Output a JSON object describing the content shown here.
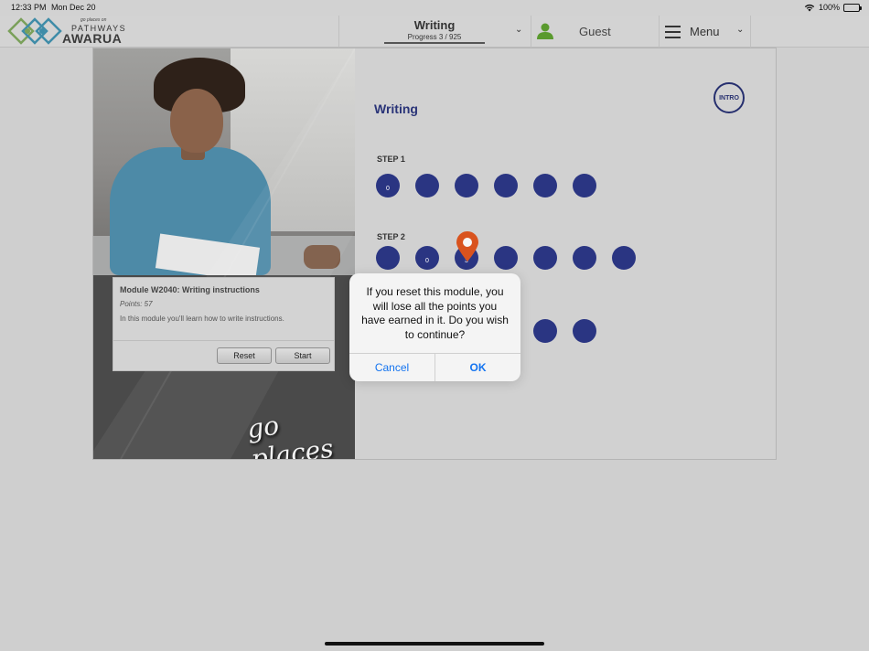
{
  "status_bar": {
    "time": "12:33 PM",
    "date": "Mon Dec 20",
    "battery": "100%",
    "battery_level": 1.0
  },
  "header": {
    "logo": {
      "tagline": "go places on",
      "line1": "PATHWAYS",
      "line2": "AWARUA"
    },
    "title": "Writing",
    "progress_text": "Progress  3 / 925",
    "user_label": "Guest",
    "menu_label": "Menu"
  },
  "module_card": {
    "title": "Module W2040: Writing instructions",
    "points": "Points: 57",
    "description": "In this module you'll learn how to write instructions.",
    "reset_label": "Reset",
    "start_label": "Start"
  },
  "banner_text": "go places",
  "map": {
    "heading": "Writing",
    "intro_label": "INTRO",
    "steps": [
      {
        "label": "STEP 1",
        "dots": [
          "0",
          "",
          "",
          "",
          "",
          ""
        ]
      },
      {
        "label": "STEP 2",
        "dots": [
          "",
          "0",
          "3",
          "",
          "",
          "",
          ""
        ]
      }
    ]
  },
  "dialog": {
    "message": "If you reset this module, you will lose all the points you have earned in it. Do you wish to continue?",
    "cancel_label": "Cancel",
    "ok_label": "OK"
  },
  "colors": {
    "accent_blue": "#2a3582",
    "link_blue": "#1474f0",
    "pin_orange": "#d9531e",
    "user_green": "#5a9a2e"
  }
}
